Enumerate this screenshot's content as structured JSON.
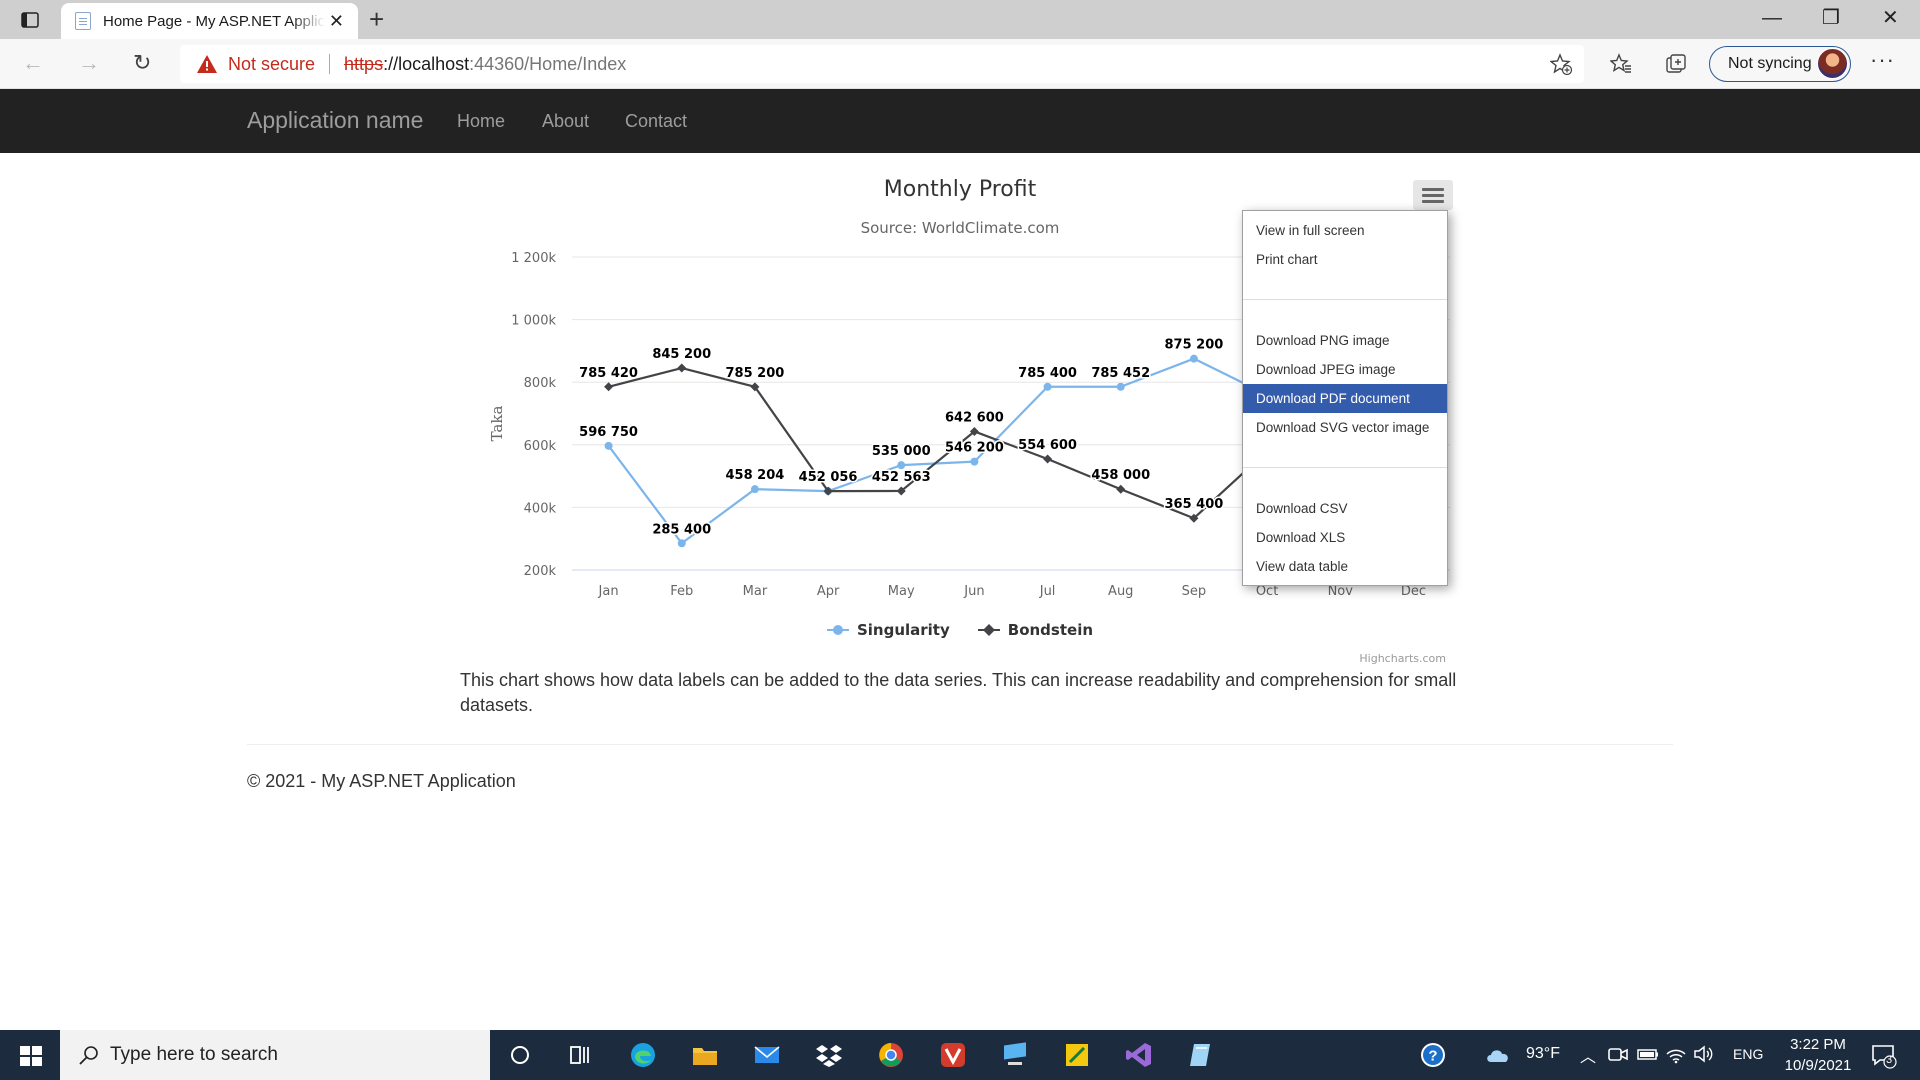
{
  "browser": {
    "tab_title": "Home Page - My ASP.NET Application",
    "not_secure": "Not secure",
    "url_scheme": "https",
    "url_host": "://localhost",
    "url_path": ":44360/Home/Index",
    "sync_label": "Not syncing"
  },
  "navbar": {
    "brand": "Application name",
    "links": [
      "Home",
      "About",
      "Contact"
    ]
  },
  "chart_data": {
    "type": "line",
    "title": "Monthly Profit",
    "subtitle": "Source: WorldClimate.com",
    "ylabel": "Taka",
    "ylim": [
      200000,
      1200000
    ],
    "yticks": [
      "200k",
      "400k",
      "600k",
      "800k",
      "1 000k",
      "1 200k"
    ],
    "categories": [
      "Jan",
      "Feb",
      "Mar",
      "Apr",
      "May",
      "Jun",
      "Jul",
      "Aug",
      "Sep",
      "Oct",
      "Nov",
      "Dec"
    ],
    "series": [
      {
        "name": "Singularity",
        "color": "#7cb5ec",
        "marker": "circle",
        "values": [
          596750,
          285400,
          458204,
          452056,
          535000,
          546200,
          785400,
          785452,
          875200,
          760000,
          null,
          null
        ],
        "labels": [
          "596 750",
          "285 400",
          "458 204",
          "452 056",
          "535 000",
          "546 200",
          "785 400",
          "785 452",
          "875 200",
          null,
          null,
          null
        ]
      },
      {
        "name": "Bondstein",
        "color": "#434348",
        "marker": "diamond",
        "values": [
          785420,
          845200,
          785200,
          452056,
          452563,
          642600,
          554600,
          458000,
          365400,
          580000,
          null,
          null
        ],
        "labels": [
          "785 420",
          "845 200",
          "785 200",
          null,
          "452 563",
          "642 600",
          "554 600",
          "458 000",
          "365 400",
          null,
          null,
          null
        ]
      }
    ],
    "legend_position": "bottom-center",
    "grid": true,
    "credits": "Highcharts.com"
  },
  "export_menu": {
    "group1": [
      "View in full screen",
      "Print chart"
    ],
    "group2": [
      "Download PNG image",
      "Download JPEG image",
      "Download PDF document",
      "Download SVG vector image"
    ],
    "group3": [
      "Download CSV",
      "Download XLS",
      "View data table"
    ],
    "highlighted": "Download PDF document"
  },
  "page": {
    "description": "This chart shows how data labels can be added to the data series. This can increase readability and comprehension for small datasets.",
    "footer": "© 2021 - My ASP.NET Application"
  },
  "taskbar": {
    "search_placeholder": "Type here to search",
    "weather": "93°F",
    "language": "ENG",
    "time": "3:22 PM",
    "date": "10/9/2021",
    "notification_count": "3"
  }
}
